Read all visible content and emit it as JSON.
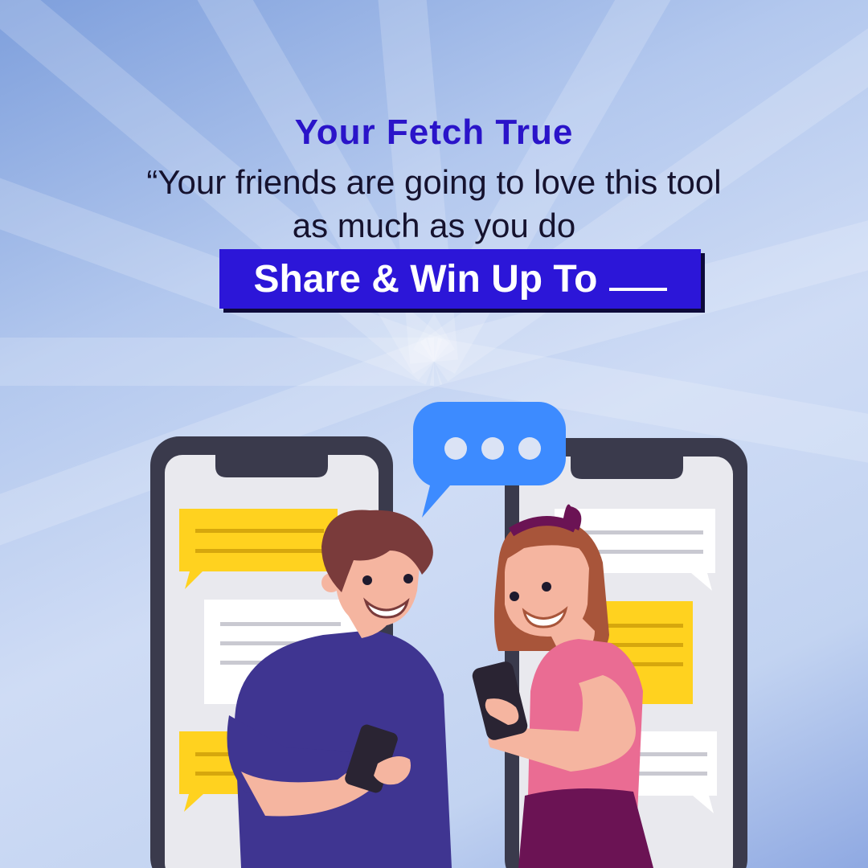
{
  "header": {
    "title": "Your Fetch True",
    "quote_line_1": "“Your friends are going to love this tool",
    "quote_line_2": "as much as you do"
  },
  "cta": {
    "label": "Share & Win Up To"
  },
  "icons": {
    "typing_bubble": "chat-bubble-ellipsis-icon",
    "phone_left": "smartphone-icon",
    "phone_right": "smartphone-icon"
  },
  "colors": {
    "title": "#2a14c9",
    "cta_background": "#2c16d8",
    "chat_yellow": "#ffd21f",
    "chat_bubble_blue": "#3d8bff",
    "boy_shirt": "#3f3591",
    "girl_shirt": "#ea6c93"
  }
}
